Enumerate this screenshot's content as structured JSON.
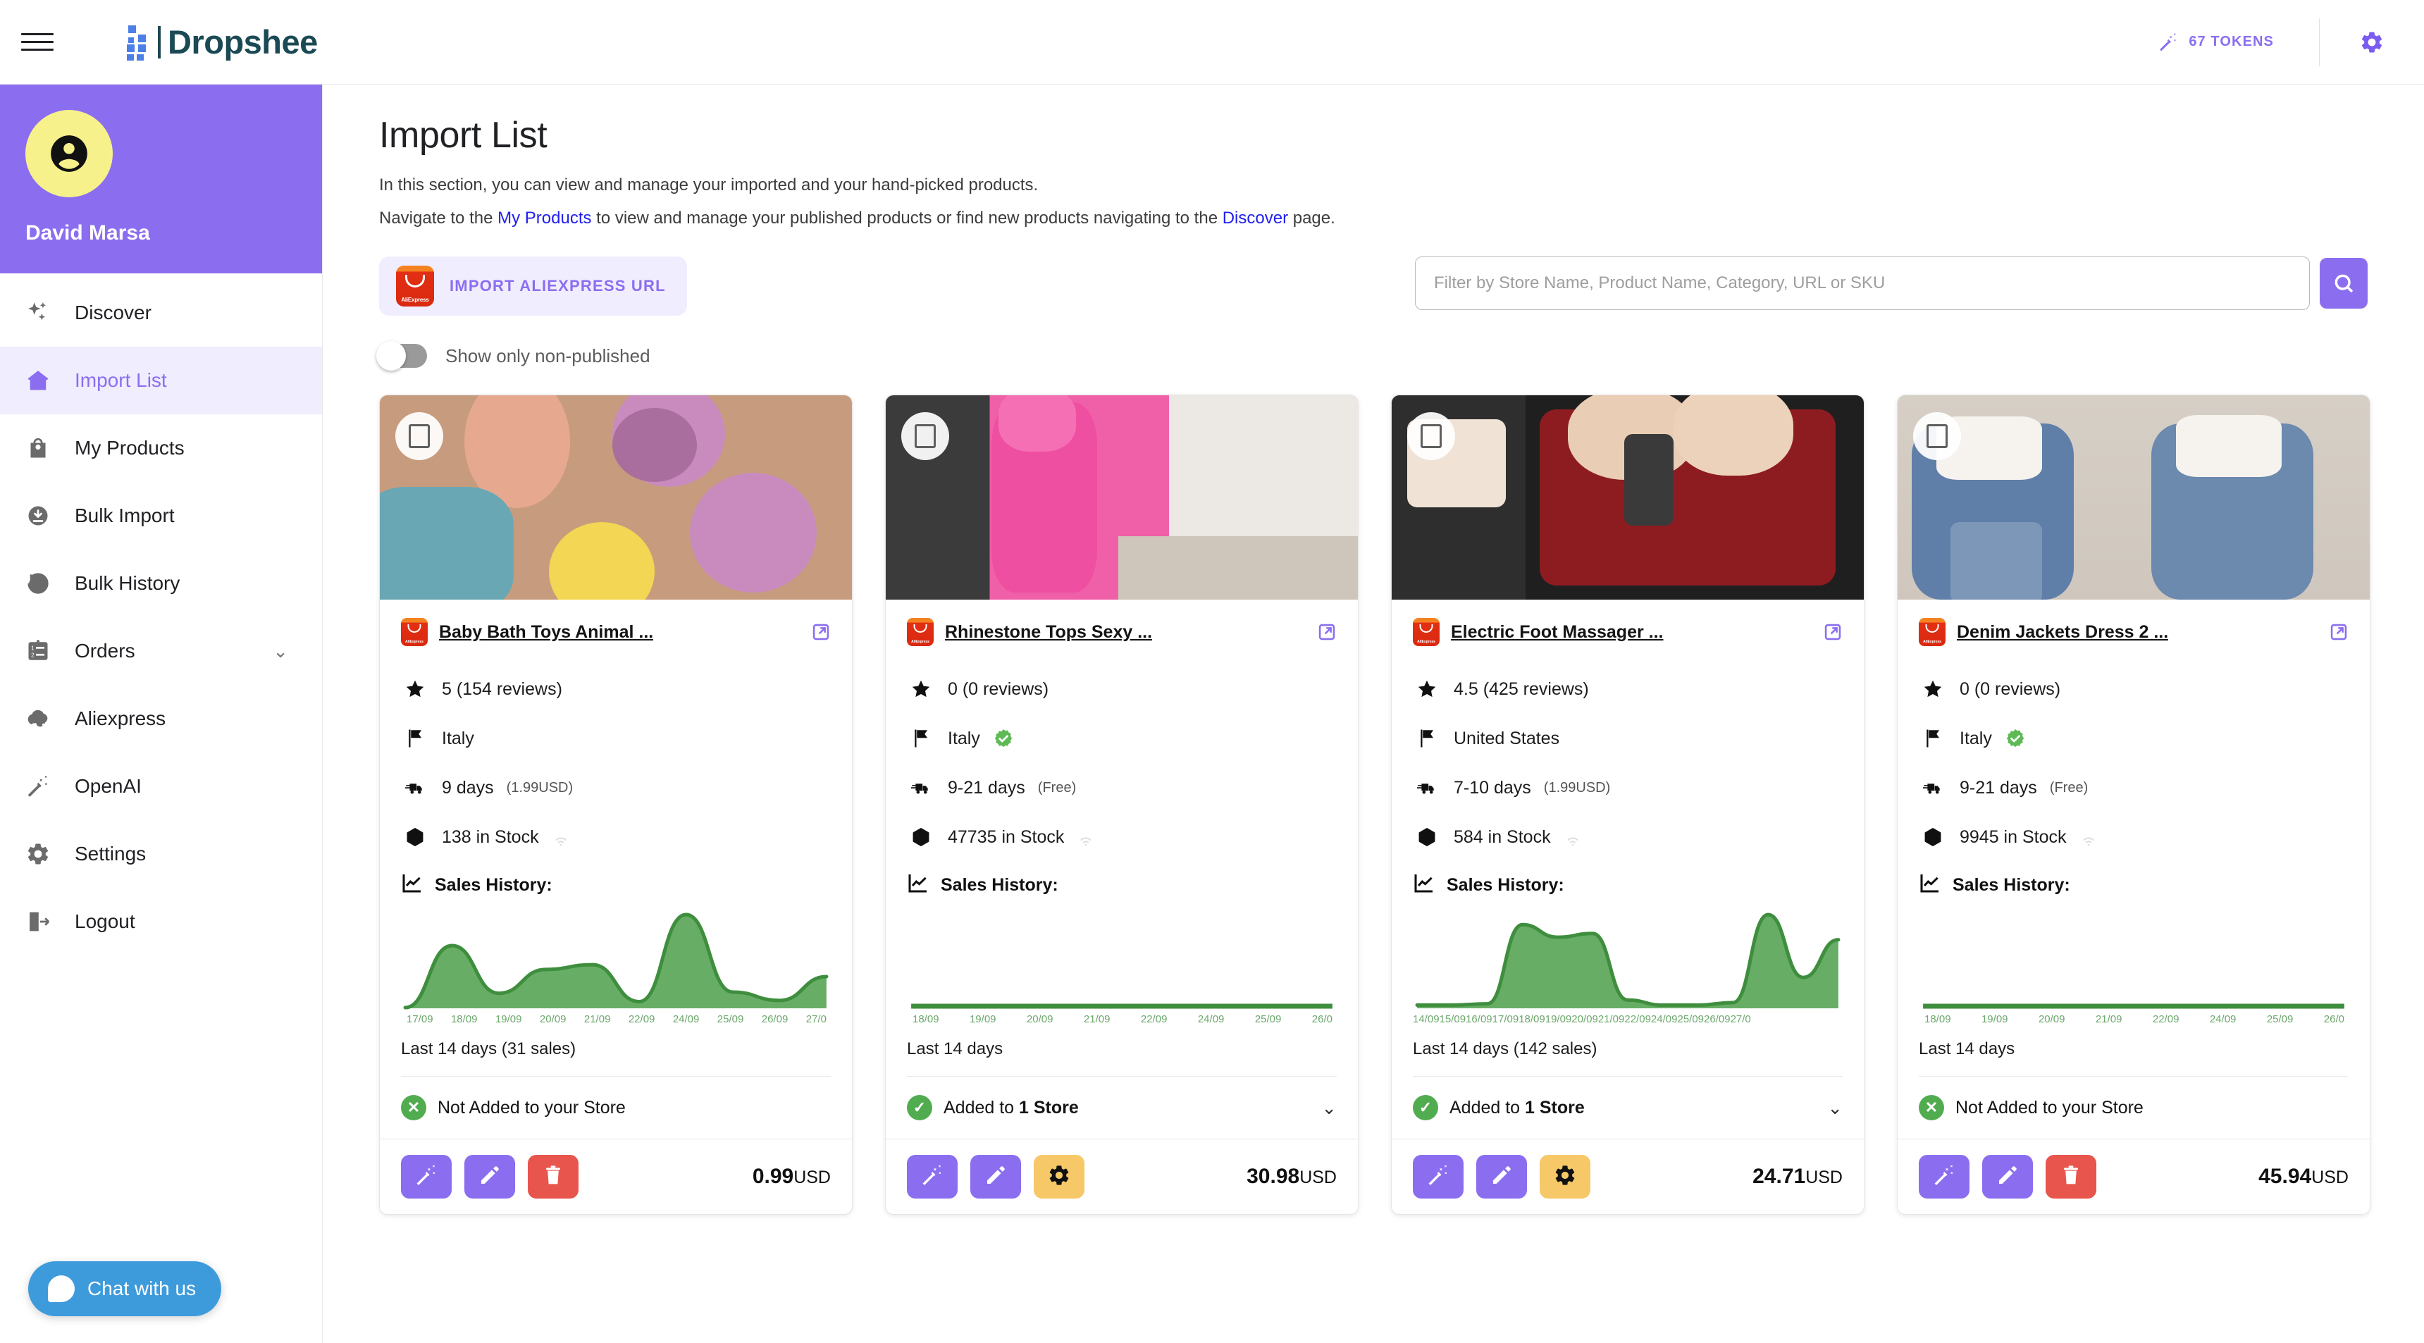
{
  "topbar": {
    "menu_icon": "hamburger-icon",
    "brand": "Dropshee",
    "tokens_label": "67 TOKENS",
    "tokens_icon": "magic-wand-icon",
    "settings_icon": "gear-icon"
  },
  "sidebar": {
    "user_name": "David Marsa",
    "avatar_icon": "account-circle-icon",
    "items": [
      {
        "label": "Discover",
        "icon": "sparkles-icon",
        "active": false,
        "chevron": false
      },
      {
        "label": "Import List",
        "icon": "import-home-icon",
        "active": true,
        "chevron": false
      },
      {
        "label": "My Products",
        "icon": "shopping-bag-icon",
        "active": false,
        "chevron": false
      },
      {
        "label": "Bulk Import",
        "icon": "download-circle-icon",
        "active": false,
        "chevron": false
      },
      {
        "label": "Bulk History",
        "icon": "history-clock-icon",
        "active": false,
        "chevron": false
      },
      {
        "label": "Orders",
        "icon": "list-numbered-icon",
        "active": false,
        "chevron": true,
        "chevron_glyph": "⌄"
      },
      {
        "label": "Aliexpress",
        "icon": "cloud-sync-icon",
        "active": false,
        "chevron": false
      },
      {
        "label": "OpenAI",
        "icon": "magic-wand-icon",
        "active": false,
        "chevron": false
      },
      {
        "label": "Settings",
        "icon": "gear-icon",
        "active": false,
        "chevron": false
      },
      {
        "label": "Logout",
        "icon": "logout-icon",
        "active": false,
        "chevron": false
      }
    ]
  },
  "chat": {
    "label": "Chat with us",
    "icon": "chat-bubble-icon"
  },
  "page": {
    "title": "Import List",
    "desc_line1": "In this section, you can view and manage your imported and your hand-picked products.",
    "desc_line2_before": "Navigate to the ",
    "desc_link1": "My Products",
    "desc_line2_middle": " to view and manage your published products or find new products navigating to the ",
    "desc_link2": "Discover",
    "desc_line2_after": " page."
  },
  "toolbar": {
    "import_label": "IMPORT ALIEXPRESS URL",
    "import_icon": "aliexpress-logo-icon",
    "aliexpress_wordmark": "AliExpress",
    "search_placeholder": "Filter by Store Name, Product Name, Category, URL or SKU",
    "search_value": "",
    "search_icon": "search-icon",
    "toggle_label": "Show only non-published",
    "toggle_on": false
  },
  "colors": {
    "brand_purple": "#8b6ef0",
    "brand_dark": "#1b4a55",
    "link_blue": "#2020ee",
    "chart_green": "#4c9a4c",
    "chart_fill": "#6cb06a",
    "danger_red": "#e8554c",
    "amber": "#f6c868",
    "chat_blue": "#3d9bdc"
  },
  "cards": [
    {
      "title": "Baby Bath Toys Animal ...",
      "source_icon": "aliexpress-logo-icon",
      "external_icon": "external-link-icon",
      "checkbox_checked": false,
      "rating": "5 (154 reviews)",
      "rating_icon": "star-icon",
      "country": "Italy",
      "country_icon": "flag-icon",
      "verified": false,
      "shipping_days": "9 days",
      "shipping_cost": "(1.99USD)",
      "shipping_icon": "truck-icon",
      "stock": "138 in Stock",
      "stock_icon": "box-icon",
      "sales_history_label": "Sales History:",
      "sales_icon": "line-chart-icon",
      "last_days": "Last 14 days (31 sales)",
      "status_text_prefix": "Not Added to your Store",
      "status_icon": "cross-circle-icon",
      "status_added": false,
      "has_chevron": false,
      "price_main": "0.99",
      "price_unit": "USD",
      "actions": [
        {
          "name": "magic-wand-button",
          "icon": "magic-wand-icon",
          "style": "purple"
        },
        {
          "name": "edit-button",
          "icon": "pencil-icon",
          "style": "purple"
        },
        {
          "name": "delete-button",
          "icon": "trash-icon",
          "style": "red"
        }
      ]
    },
    {
      "title": "Rhinestone Tops Sexy ...",
      "source_icon": "aliexpress-logo-icon",
      "external_icon": "external-link-icon",
      "checkbox_checked": false,
      "rating": "0 (0 reviews)",
      "rating_icon": "star-icon",
      "country": "Italy",
      "country_icon": "flag-icon",
      "verified": true,
      "shipping_days": "9-21 days",
      "shipping_cost": "(Free)",
      "shipping_icon": "truck-icon",
      "stock": "47735 in Stock",
      "stock_icon": "box-icon",
      "sales_history_label": "Sales History:",
      "sales_icon": "line-chart-icon",
      "last_days": "Last 14 days",
      "status_text_prefix": "Added to ",
      "status_text_bold": "1 Store",
      "status_icon": "check-circle-icon",
      "status_added": true,
      "has_chevron": true,
      "chevron_glyph": "⌄",
      "price_main": "30.98",
      "price_unit": "USD",
      "actions": [
        {
          "name": "magic-wand-button",
          "icon": "magic-wand-icon",
          "style": "purple"
        },
        {
          "name": "edit-button",
          "icon": "pencil-icon",
          "style": "purple"
        },
        {
          "name": "settings-button",
          "icon": "gear-icon",
          "style": "amber"
        }
      ]
    },
    {
      "title": "Electric Foot Massager ...",
      "source_icon": "aliexpress-logo-icon",
      "external_icon": "external-link-icon",
      "checkbox_checked": false,
      "rating": "4.5 (425 reviews)",
      "rating_icon": "star-icon",
      "country": "United States",
      "country_icon": "flag-icon",
      "verified": false,
      "shipping_days": "7-10 days",
      "shipping_cost": "(1.99USD)",
      "shipping_icon": "truck-icon",
      "stock": "584 in Stock",
      "stock_icon": "box-icon",
      "sales_history_label": "Sales History:",
      "sales_icon": "line-chart-icon",
      "last_days": "Last 14 days (142 sales)",
      "status_text_prefix": "Added to ",
      "status_text_bold": "1 Store",
      "status_icon": "check-circle-icon",
      "status_added": true,
      "has_chevron": true,
      "chevron_glyph": "⌄",
      "price_main": "24.71",
      "price_unit": "USD",
      "actions": [
        {
          "name": "magic-wand-button",
          "icon": "magic-wand-icon",
          "style": "purple"
        },
        {
          "name": "edit-button",
          "icon": "pencil-icon",
          "style": "purple"
        },
        {
          "name": "settings-button",
          "icon": "gear-icon",
          "style": "amber"
        }
      ]
    },
    {
      "title": "Denim Jackets Dress 2 ...",
      "source_icon": "aliexpress-logo-icon",
      "external_icon": "external-link-icon",
      "checkbox_checked": false,
      "rating": "0 (0 reviews)",
      "rating_icon": "star-icon",
      "country": "Italy",
      "country_icon": "flag-icon",
      "verified": true,
      "shipping_days": "9-21 days",
      "shipping_cost": "(Free)",
      "shipping_icon": "truck-icon",
      "stock": "9945 in Stock",
      "stock_icon": "box-icon",
      "sales_history_label": "Sales History:",
      "sales_icon": "line-chart-icon",
      "last_days": "Last 14 days",
      "status_text_prefix": "Not Added to your Store",
      "status_icon": "cross-circle-icon",
      "status_added": false,
      "has_chevron": false,
      "price_main": "45.94",
      "price_unit": "USD",
      "actions": [
        {
          "name": "magic-wand-button",
          "icon": "magic-wand-icon",
          "style": "purple"
        },
        {
          "name": "edit-button",
          "icon": "pencil-icon",
          "style": "purple"
        },
        {
          "name": "delete-button",
          "icon": "trash-icon",
          "style": "red"
        }
      ]
    }
  ],
  "chart_data": [
    {
      "type": "area",
      "title": "Sales History:",
      "card": "Baby Bath Toys Animal ...",
      "categories": [
        "17/09",
        "18/09",
        "19/09",
        "20/09",
        "21/09",
        "22/09",
        "24/09",
        "25/09",
        "26/09",
        "27/0"
      ],
      "values": [
        0,
        5.2,
        1.2,
        3.2,
        3.6,
        0.5,
        7.8,
        1.3,
        0.6,
        2.6
      ],
      "ylabel": "sales",
      "xlabel": "",
      "grid": false,
      "total_label": "Last 14 days (31 sales)",
      "total_sales": 31
    },
    {
      "type": "area",
      "title": "Sales History:",
      "card": "Rhinestone Tops Sexy ...",
      "categories": [
        "18/09",
        "19/09",
        "20/09",
        "21/09",
        "22/09",
        "24/09",
        "25/09",
        "26/0"
      ],
      "values": [
        0,
        0,
        0,
        0,
        0,
        0,
        0,
        0
      ],
      "ylabel": "sales",
      "xlabel": "",
      "grid": false,
      "total_label": "Last 14 days",
      "total_sales": 0
    },
    {
      "type": "area",
      "title": "Sales History:",
      "card": "Electric Foot Massager ...",
      "categories": [
        "14/09",
        "15/09",
        "16/09",
        "17/09",
        "18/09",
        "19/09",
        "20/09",
        "21/09",
        "22/09",
        "24/09",
        "25/09",
        "26/09",
        "27/0"
      ],
      "values": [
        0.2,
        0.2,
        0.3,
        6.6,
        5.6,
        5.9,
        0.6,
        0.2,
        0.2,
        0.4,
        7.4,
        2.4,
        5.4
      ],
      "ylabel": "sales",
      "xlabel": "",
      "grid": false,
      "total_label": "Last 14 days (142 sales)",
      "total_sales": 142
    },
    {
      "type": "area",
      "title": "Sales History:",
      "card": "Denim Jackets Dress 2 ...",
      "categories": [
        "18/09",
        "19/09",
        "20/09",
        "21/09",
        "22/09",
        "24/09",
        "25/09",
        "26/0"
      ],
      "values": [
        0,
        0,
        0,
        0,
        0,
        0,
        0,
        0
      ],
      "ylabel": "sales",
      "xlabel": "",
      "grid": false,
      "total_label": "Last 14 days",
      "total_sales": 0
    }
  ]
}
